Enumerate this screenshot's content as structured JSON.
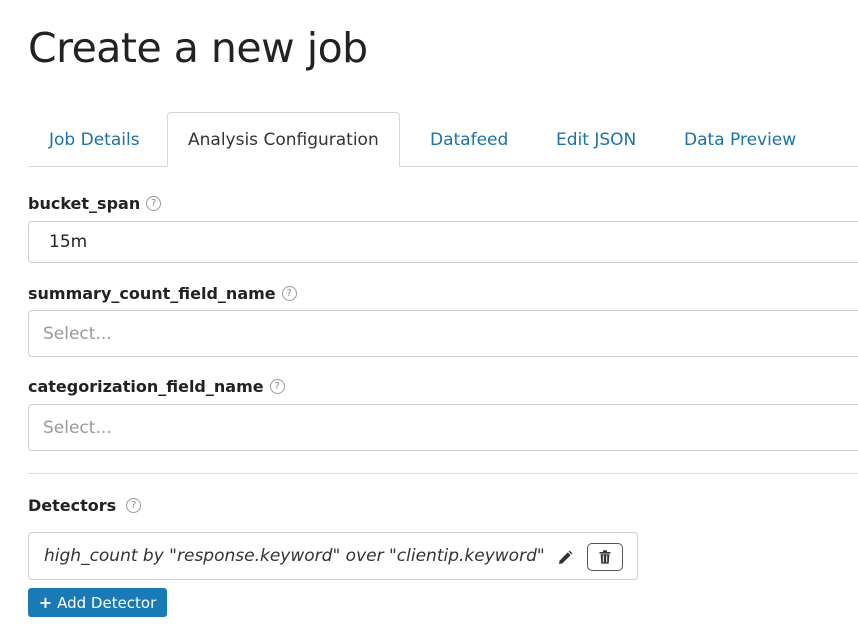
{
  "page": {
    "title": "Create a new job"
  },
  "tabs": [
    {
      "label": "Job Details",
      "active": false
    },
    {
      "label": "Analysis Configuration",
      "active": true
    },
    {
      "label": "Datafeed",
      "active": false
    },
    {
      "label": "Edit JSON",
      "active": false
    },
    {
      "label": "Data Preview",
      "active": false
    }
  ],
  "fields": {
    "bucket_span": {
      "label": "bucket_span",
      "value": "15m"
    },
    "summary_count_field_name": {
      "label": "summary_count_field_name",
      "placeholder": "Select..."
    },
    "categorization_field_name": {
      "label": "categorization_field_name",
      "placeholder": "Select..."
    }
  },
  "detectors": {
    "label": "Detectors",
    "items": [
      {
        "description": "high_count by \"response.keyword\" over \"clientip.keyword\""
      }
    ],
    "add_label": "Add Detector"
  },
  "icons": {
    "help": "help-circle-icon",
    "edit": "pencil-icon",
    "delete": "trash-icon",
    "add": "plus-icon"
  },
  "colors": {
    "accent": "#1a7ab5",
    "link": "#1a73a8"
  }
}
